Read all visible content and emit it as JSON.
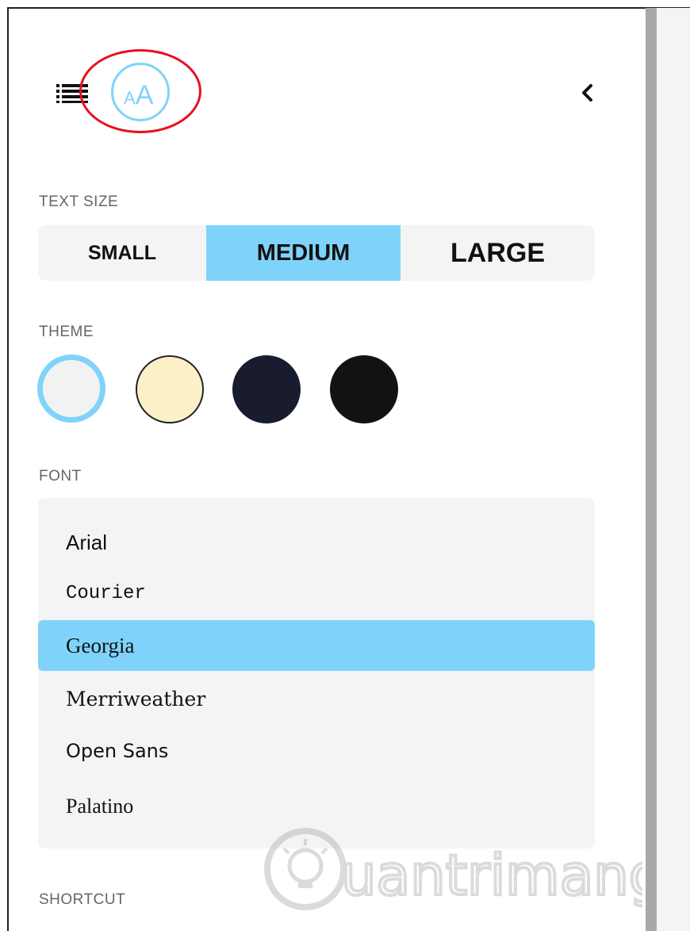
{
  "toolbar": {
    "toc_icon": "list-icon",
    "display_settings_icon": "text-size-icon",
    "display_settings_label": "AA",
    "back_icon": "chevron-left-icon"
  },
  "text_size": {
    "label": "TEXT SIZE",
    "options": [
      "SMALL",
      "MEDIUM",
      "LARGE"
    ],
    "selected": "MEDIUM"
  },
  "theme": {
    "label": "THEME",
    "options": [
      {
        "color": "#f2f2f2",
        "selected": true
      },
      {
        "color": "#fcf0c8",
        "selected": false
      },
      {
        "color": "#191c2e",
        "selected": false
      },
      {
        "color": "#121212",
        "selected": false
      }
    ],
    "accent": "#7fd3fa"
  },
  "font": {
    "label": "FONT",
    "options": [
      "Arial",
      "Courier",
      "Georgia",
      "Merriweather",
      "Open Sans",
      "Palatino"
    ],
    "selected": "Georgia"
  },
  "shortcut": {
    "label": "SHORTCUT"
  },
  "watermark": {
    "text": "uantrimang",
    "icon": "lightbulb-icon"
  }
}
